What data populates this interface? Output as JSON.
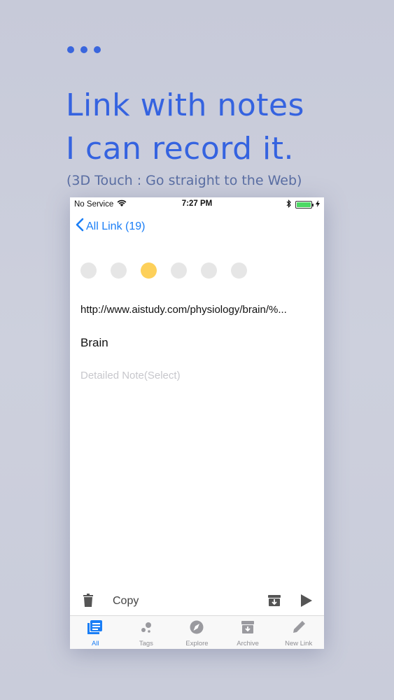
{
  "header": {
    "headline_line1": "Link with notes",
    "headline_line2": "I can record it.",
    "subline": "(3D Touch : Go straight to the Web)"
  },
  "statusbar": {
    "carrier": "No Service",
    "time": "7:27 PM"
  },
  "navbar": {
    "back_label": "All Link (19)"
  },
  "colors": {
    "swatches": [
      "#e6e6e6",
      "#e6e6e6",
      "#fdd05a",
      "#e6e6e6",
      "#e6e6e6",
      "#e6e6e6"
    ],
    "selected_index": 2
  },
  "link": {
    "url": "http://www.aistudy.com/physiology/brain/%...",
    "title": "Brain",
    "note_placeholder": "Detailed Note(Select)"
  },
  "actionbar": {
    "copy_label": "Copy"
  },
  "tabbar": {
    "tabs": [
      {
        "label": "All",
        "icon": "list-icon",
        "active": true
      },
      {
        "label": "Tags",
        "icon": "tags-icon",
        "active": false
      },
      {
        "label": "Explore",
        "icon": "compass-icon",
        "active": false
      },
      {
        "label": "Archive",
        "icon": "archive-icon",
        "active": false
      },
      {
        "label": "New Link",
        "icon": "pencil-icon",
        "active": false
      }
    ]
  },
  "theme": {
    "accent": "#1a7ef6",
    "headline_color": "#3563e0"
  }
}
